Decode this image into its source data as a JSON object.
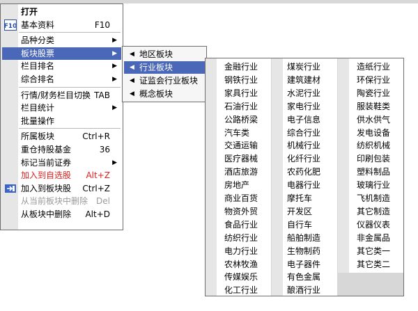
{
  "main_menu": {
    "items": [
      {
        "label": "打开",
        "style": "bold"
      },
      {
        "label": "基本资料",
        "shortcut": "F10",
        "icon": "f10-icon"
      },
      {
        "separator": true
      },
      {
        "label": "品种分类",
        "submenu": true
      },
      {
        "label": "板块股票",
        "submenu": true,
        "highlighted": true
      },
      {
        "label": "栏目排名",
        "submenu": true
      },
      {
        "label": "综合排名",
        "submenu": true
      },
      {
        "separator": true
      },
      {
        "label": "行情/财务栏目切换",
        "shortcut": "TAB"
      },
      {
        "label": "栏目统计",
        "submenu": true
      },
      {
        "label": "批量操作"
      },
      {
        "separator": true
      },
      {
        "label": "所属板块",
        "shortcut": "Ctrl+R"
      },
      {
        "label": "重仓持股基金",
        "shortcut": "36"
      },
      {
        "label": "标记当前证券",
        "submenu": true
      },
      {
        "label": "加入到自选股",
        "shortcut": "Alt+Z",
        "style": "red"
      },
      {
        "label": "加入到板块股",
        "shortcut": "Ctrl+Z",
        "icon": "add-to-block-icon"
      },
      {
        "label": "从当前板块中删除",
        "shortcut": "Del",
        "style": "disabled"
      },
      {
        "label": "从板块中删除",
        "shortcut": "Alt+D"
      }
    ]
  },
  "block_submenu": {
    "items": [
      {
        "label": "地区板块"
      },
      {
        "label": "行业板块",
        "highlighted": true
      },
      {
        "label": "证监会行业板块"
      },
      {
        "label": "概念板块"
      }
    ]
  },
  "industry_grid": {
    "columns": [
      [
        "金融行业",
        "钢铁行业",
        "家具行业",
        "石油行业",
        "公路桥梁",
        "汽车类",
        "交通运输",
        "医疗器械",
        "酒店旅游",
        "房地产",
        "商业百货",
        "物资外贸",
        "食品行业",
        "纺织行业",
        "电力行业",
        "农林牧渔",
        "传媒娱乐",
        "化工行业"
      ],
      [
        "煤炭行业",
        "建筑建材",
        "水泥行业",
        "家电行业",
        "电子信息",
        "综合行业",
        "机械行业",
        "化纤行业",
        "农药化肥",
        "电器行业",
        "摩托车",
        "开发区",
        "自行车",
        "船舶制造",
        "生物制药",
        "电子器件",
        "有色金属",
        "酿酒行业"
      ],
      [
        "造纸行业",
        "环保行业",
        "陶瓷行业",
        "服装鞋类",
        "供水供气",
        "发电设备",
        "纺织机械",
        "印刷包装",
        "塑料制品",
        "玻璃行业",
        "飞机制造",
        "其它制造",
        "仪器仪表",
        "非金属品",
        "其它类一",
        "其它类二"
      ]
    ]
  }
}
